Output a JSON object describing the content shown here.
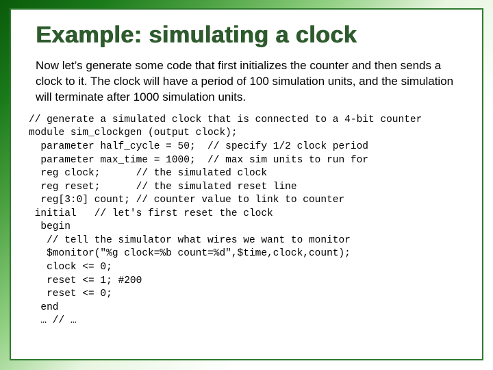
{
  "title": "Example: simulating a clock",
  "intro": "Now let’s generate some code that first initializes the counter and then sends a clock to it. The clock will have a period of 100 simulation units, and the simulation will terminate after 1000 simulation units.",
  "code": "// generate a simulated clock that is connected to a 4-bit counter\nmodule sim_clockgen (output clock);\n  parameter half_cycle = 50;  // specify 1/2 clock period\n  parameter max_time = 1000;  // max sim units to run for\n  reg clock;      // the simulated clock\n  reg reset;      // the simulated reset line\n  reg[3:0] count; // counter value to link to counter\n initial   // let's first reset the clock\n  begin\n   // tell the simulator what wires we want to monitor\n   $monitor(\"%g clock=%b count=%d\",$time,clock,count);\n   clock <= 0;\n   reset <= 1; #200\n   reset <= 0;\n  end\n  … // …"
}
